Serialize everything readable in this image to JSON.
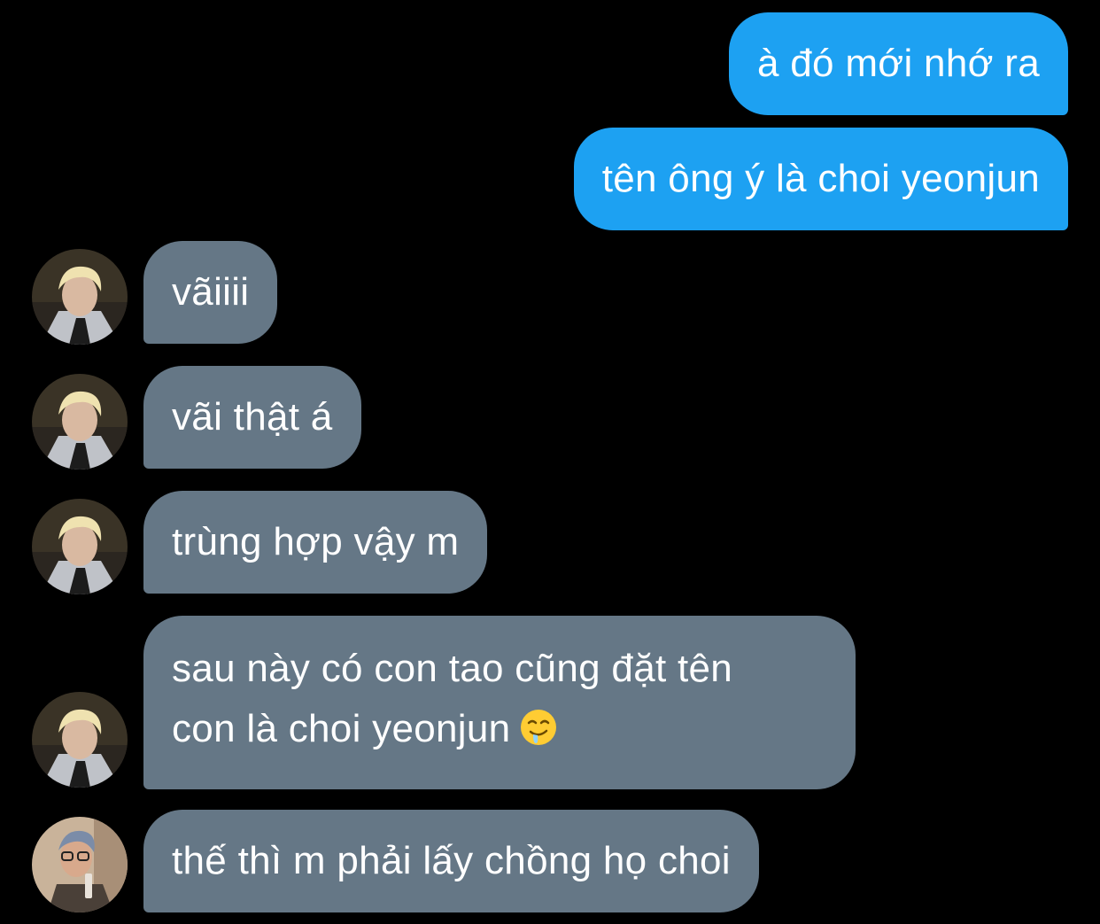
{
  "colors": {
    "background": "#000000",
    "sent_bubble": "#1da1f2",
    "received_bubble": "#657786",
    "text": "#ffffff"
  },
  "messages": [
    {
      "direction": "sent",
      "text": "à đó mới nhớ ra"
    },
    {
      "direction": "sent",
      "text": "tên ông ý là choi yeonjun"
    },
    {
      "direction": "received",
      "avatar": "avatar-blonde",
      "text": "vãiiii"
    },
    {
      "direction": "received",
      "avatar": "avatar-blonde",
      "text": "vãi thật á"
    },
    {
      "direction": "received",
      "avatar": "avatar-blonde",
      "text": "trùng hợp vậy m"
    },
    {
      "direction": "received",
      "avatar": "avatar-blonde",
      "lines": [
        "sau này có con tao cũng đặt tên",
        "con là choi yeonjun"
      ],
      "emoji": "drooling-face-emoji"
    },
    {
      "direction": "received",
      "avatar": "avatar-glasses",
      "text": "thế thì m phải lấy chồng họ choi"
    }
  ]
}
